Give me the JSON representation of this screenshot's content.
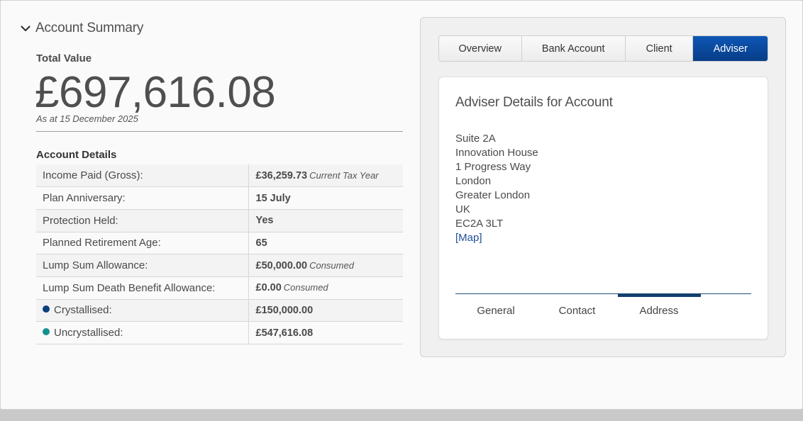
{
  "summary": {
    "title": "Account Summary",
    "total_value_label": "Total Value",
    "total_value": "£697,616.08",
    "as_at": "As at 15 December 2025"
  },
  "account_details": {
    "title": "Account Details",
    "rows": [
      {
        "label": "Income Paid (Gross):",
        "value": "£36,259.73",
        "note": "Current Tax Year"
      },
      {
        "label": "Plan Anniversary:",
        "value": "15 July",
        "note": ""
      },
      {
        "label": "Protection Held:",
        "value": "Yes",
        "note": ""
      },
      {
        "label": "Planned Retirement Age:",
        "value": "65",
        "note": ""
      },
      {
        "label": "Lump Sum Allowance:",
        "value": "£50,000.00",
        "note": "Consumed"
      },
      {
        "label": "Lump Sum Death Benefit Allowance:",
        "value": "£0.00",
        "note": "Consumed"
      },
      {
        "label": "Crystallised:",
        "value": "£150,000.00",
        "note": "",
        "dot_color": "#0b3f80"
      },
      {
        "label": "Uncrystallised:",
        "value": "£547,616.08",
        "note": "",
        "dot_color": "#139090"
      }
    ]
  },
  "tabs": [
    {
      "label": "Overview"
    },
    {
      "label": "Bank Account"
    },
    {
      "label": "Client"
    },
    {
      "label": "Adviser",
      "active": true
    }
  ],
  "adviser": {
    "title": "Adviser Details for Account",
    "address_lines": [
      "Suite 2A",
      "Innovation House",
      "1 Progress Way",
      "London",
      "Greater London",
      "UK",
      "EC2A 3LT"
    ],
    "map_link": "[Map]",
    "subtabs": [
      {
        "label": "General"
      },
      {
        "label": "Contact"
      },
      {
        "label": "Address",
        "active": true
      }
    ]
  },
  "colors": {
    "accent": "#0a4a9f",
    "crystallised": "#0b3f80",
    "uncrystallised": "#139090"
  }
}
